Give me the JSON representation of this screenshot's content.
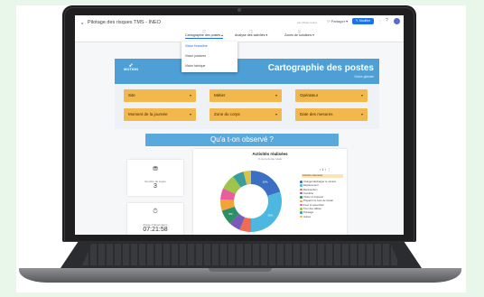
{
  "app": {
    "title": "Pilotage des risques TMS - INEO",
    "owner": "par Olivier Guiot",
    "share_label": "Partager",
    "edit_label": "Modifier",
    "icons": {
      "logo": "looker-studio-icon",
      "share": "person-add-icon",
      "edit": "pencil-icon",
      "more": "more-vert-icon",
      "help": "help-icon"
    }
  },
  "tabs": [
    {
      "label": "Cartographie des postes",
      "active": true
    },
    {
      "label": "Analyse des activités",
      "active": false
    },
    {
      "label": "Zones de solutions",
      "active": false
    }
  ],
  "menu": [
    {
      "label": "Vision financière",
      "selected": true
    },
    {
      "label": "Vision postures",
      "selected": false
    },
    {
      "label": "Vision fabrique",
      "selected": false
    }
  ],
  "header": {
    "brand": "MOTION",
    "title": "Cartographie des postes",
    "subtitle": "Vision globale",
    "color": "#4d9fd6"
  },
  "filters": [
    {
      "label": "Site"
    },
    {
      "label": "Métier"
    },
    {
      "label": "Opérateur"
    },
    {
      "label": "Moment de la journée"
    },
    {
      "label": "Zone du corps"
    },
    {
      "label": "Date des mesures"
    }
  ],
  "question": "Qu'a t-on observé ?",
  "kpis": [
    {
      "label": "Nombre de sujets",
      "value": "3",
      "icon": "users-icon"
    },
    {
      "label": "Durée d'observation",
      "value": "07:21:58",
      "icon": "stopwatch-icon"
    }
  ],
  "chart_data": {
    "type": "pie",
    "title": "Activités réalisées",
    "subtitle": "% de la durée totale",
    "legend_header": "Activités observées",
    "categories": [
      "Charger/décharger le camion",
      "Déplacement",
      "Manutention",
      "Conduite",
      "Visser et préparer",
      "Préparer la zone de travail",
      "Fixer et assembler",
      "Tirer des câbles",
      "Pointage",
      "Autres"
    ],
    "values": [
      20,
      30,
      6,
      6,
      8,
      6,
      6,
      8,
      6,
      4
    ],
    "labels": [
      "20%",
      "30%",
      "",
      "",
      "8%",
      "",
      "",
      "",
      "",
      ""
    ],
    "colors": [
      "#3b6fc4",
      "#4cb8df",
      "#ef6b54",
      "#7a5ab8",
      "#2e8f66",
      "#f2a43a",
      "#e85d9a",
      "#9fc44b",
      "#3a9e9c",
      "#d8c24a"
    ],
    "legend": "right",
    "controls": "‹  1  ›  ⋮"
  }
}
